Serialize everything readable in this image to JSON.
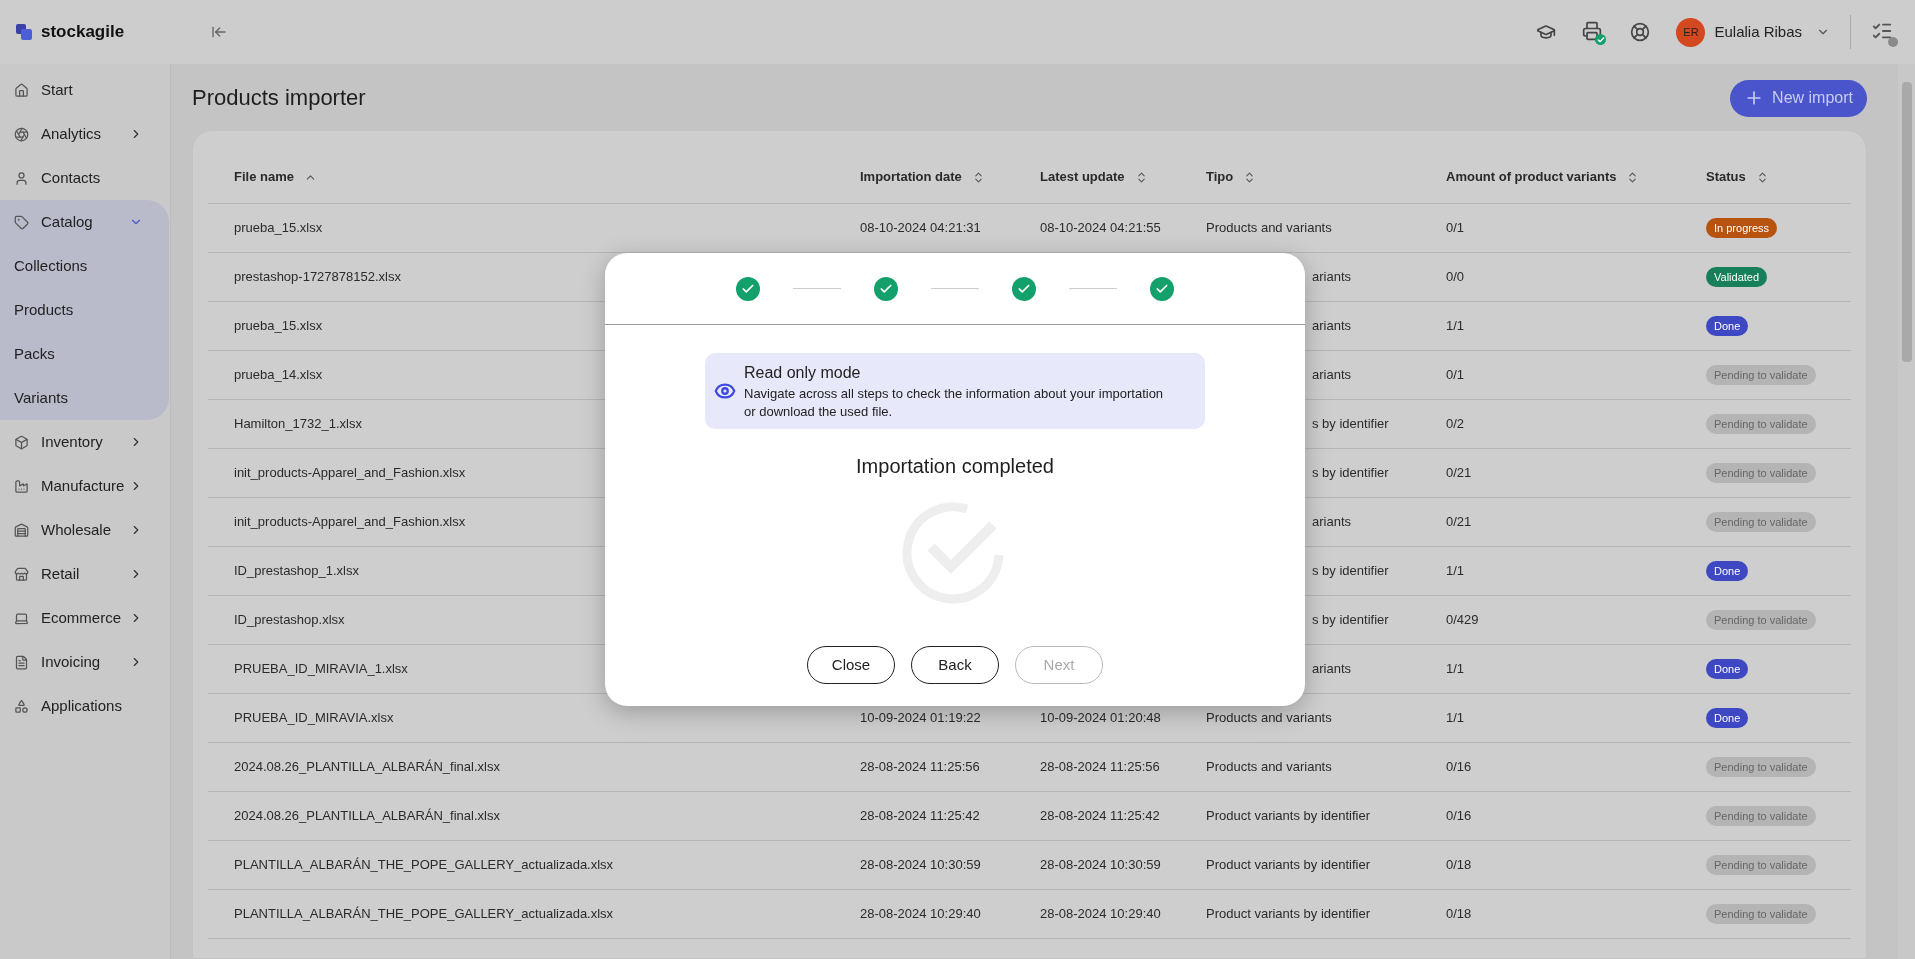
{
  "brand": {
    "name": "stockagile"
  },
  "user": {
    "initials": "ER",
    "name": "Eulalia Ribas"
  },
  "sidebar": {
    "items": [
      {
        "label": "Start"
      },
      {
        "label": "Analytics",
        "expanded": false
      },
      {
        "label": "Contacts"
      },
      {
        "label": "Catalog",
        "expanded": true,
        "children": [
          {
            "label": "Collections"
          },
          {
            "label": "Products"
          },
          {
            "label": "Packs"
          },
          {
            "label": "Variants"
          }
        ]
      },
      {
        "label": "Inventory",
        "expanded": false
      },
      {
        "label": "Manufacture",
        "expanded": false
      },
      {
        "label": "Wholesale",
        "expanded": false
      },
      {
        "label": "Retail",
        "expanded": false
      },
      {
        "label": "Ecommerce",
        "expanded": false
      },
      {
        "label": "Invoicing",
        "expanded": false
      },
      {
        "label": "Applications"
      }
    ]
  },
  "page": {
    "title": "Products importer",
    "new_button": "New import"
  },
  "table": {
    "columns": [
      {
        "label": "File name",
        "sorted": true
      },
      {
        "label": "Importation date",
        "sorted": false
      },
      {
        "label": "Latest update",
        "sorted": false
      },
      {
        "label": "Tipo",
        "sorted": false
      },
      {
        "label": "Amount of product variants",
        "sorted": false
      },
      {
        "label": "Status",
        "sorted": false
      }
    ],
    "rows": [
      {
        "file": "prueba_15.xlsx",
        "imported": "08-10-2024 04:21:31",
        "updated": "08-10-2024 04:21:55",
        "tipo": "Products and variants",
        "amount": "0/1",
        "status": {
          "label": "In progress",
          "kind": "progress"
        }
      },
      {
        "file": "prestashop-1727878152.xlsx",
        "tipo": "ariants",
        "amount": "0/0",
        "status": {
          "label": "Validated",
          "kind": "validated"
        }
      },
      {
        "file": "prueba_15.xlsx",
        "tipo": "ariants",
        "amount": "1/1",
        "status": {
          "label": "Done",
          "kind": "done"
        }
      },
      {
        "file": "prueba_14.xlsx",
        "tipo": "ariants",
        "amount": "0/1",
        "status": {
          "label": "Pending to validate",
          "kind": "pending"
        }
      },
      {
        "file": "Hamilton_1732_1.xlsx",
        "tipo": "s by identifier",
        "amount": "0/2",
        "status": {
          "label": "Pending to validate",
          "kind": "pending"
        }
      },
      {
        "file": "init_products-Apparel_and_Fashion.xlsx",
        "tipo": "s by identifier",
        "amount": "0/21",
        "status": {
          "label": "Pending to validate",
          "kind": "pending"
        }
      },
      {
        "file": "init_products-Apparel_and_Fashion.xlsx",
        "tipo": "ariants",
        "amount": "0/21",
        "status": {
          "label": "Pending to validate",
          "kind": "pending"
        }
      },
      {
        "file": "ID_prestashop_1.xlsx",
        "tipo": "s by identifier",
        "amount": "1/1",
        "status": {
          "label": "Done",
          "kind": "done"
        }
      },
      {
        "file": "ID_prestashop.xlsx",
        "tipo": "s by identifier",
        "amount": "0/429",
        "status": {
          "label": "Pending to validate",
          "kind": "pending"
        }
      },
      {
        "file": "PRUEBA_ID_MIRAVIA_1.xlsx",
        "tipo": "ariants",
        "amount": "1/1",
        "status": {
          "label": "Done",
          "kind": "done"
        }
      },
      {
        "file": "PRUEBA_ID_MIRAVIA.xlsx",
        "imported": "10-09-2024 01:19:22",
        "updated": "10-09-2024 01:20:48",
        "tipo": "Products and variants",
        "amount": "1/1",
        "status": {
          "label": "Done",
          "kind": "done"
        }
      },
      {
        "file": "2024.08.26_PLANTILLA_ALBARÁN_final.xlsx",
        "imported": "28-08-2024 11:25:56",
        "updated": "28-08-2024 11:25:56",
        "tipo": "Products and variants",
        "amount": "0/16",
        "status": {
          "label": "Pending to validate",
          "kind": "pending"
        }
      },
      {
        "file": "2024.08.26_PLANTILLA_ALBARÁN_final.xlsx",
        "imported": "28-08-2024 11:25:42",
        "updated": "28-08-2024 11:25:42",
        "tipo": "Product variants by identifier",
        "amount": "0/16",
        "status": {
          "label": "Pending to validate",
          "kind": "pending"
        }
      },
      {
        "file": "PLANTILLA_ALBARÁN_THE_POPE_GALLERY_actualizada.xlsx",
        "imported": "28-08-2024 10:30:59",
        "updated": "28-08-2024 10:30:59",
        "tipo": "Product variants by identifier",
        "amount": "0/18",
        "status": {
          "label": "Pending to validate",
          "kind": "pending"
        }
      },
      {
        "file": "PLANTILLA_ALBARÁN_THE_POPE_GALLERY_actualizada.xlsx",
        "imported": "28-08-2024 10:29:40",
        "updated": "28-08-2024 10:29:40",
        "tipo": "Product variants by identifier",
        "amount": "0/18",
        "status": {
          "label": "Pending to validate",
          "kind": "pending"
        }
      }
    ]
  },
  "modal": {
    "steps": [
      {
        "done": true
      },
      {
        "done": true
      },
      {
        "done": true
      },
      {
        "done": true
      }
    ],
    "notice": {
      "title": "Read only mode",
      "text": "Navigate across all steps to check the information about your importation or download the used file."
    },
    "heading": "Importation completed",
    "buttons": [
      {
        "label": "Close",
        "disabled": false
      },
      {
        "label": "Back",
        "disabled": false
      },
      {
        "label": "Next",
        "disabled": true
      }
    ]
  }
}
